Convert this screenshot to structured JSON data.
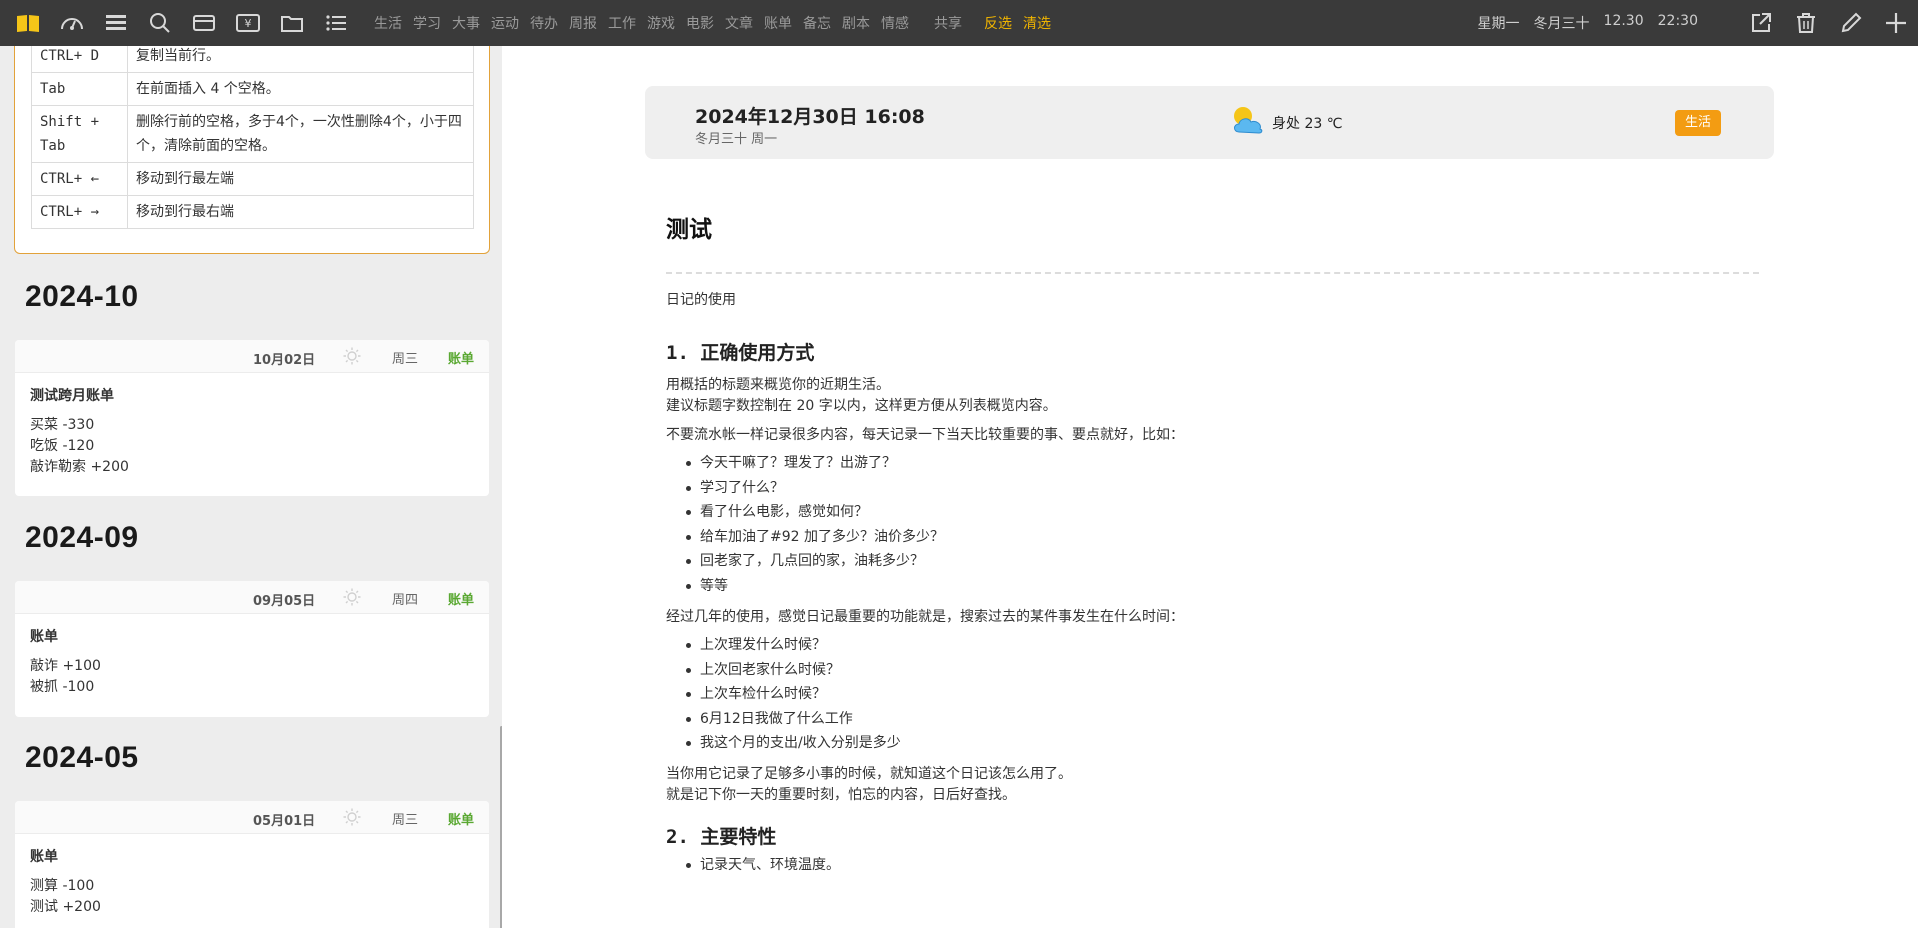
{
  "topbar": {
    "categories": [
      "生活",
      "学习",
      "大事",
      "运动",
      "待办",
      "周报",
      "工作",
      "游戏",
      "电影",
      "文章",
      "账单",
      "备忘",
      "剧本",
      "情感"
    ],
    "share": "共享",
    "invert": "反选",
    "clear": "清选",
    "date": {
      "weekday": "星期一",
      "lunar": "冬月三十",
      "md": "12.30",
      "time": "22:30"
    }
  },
  "shortcuts": [
    {
      "key": "CTRL+ D",
      "desc": "复制当前行。"
    },
    {
      "key": "Tab",
      "desc": "在前面插入 4 个空格。"
    },
    {
      "key": "Shift + Tab",
      "desc": "删除行前的空格，多于4个，一次性删除4个，小于四个，清除前面的空格。"
    },
    {
      "key": "CTRL+ ←",
      "desc": "移动到行最左端"
    },
    {
      "key": "CTRL+ →",
      "desc": "移动到行最右端"
    }
  ],
  "months": [
    {
      "label": "2024-10",
      "entry": {
        "date": "10月02日",
        "weekday": "周三",
        "tag": "账单",
        "title": "测试跨月账单",
        "lines": [
          "买菜 -330",
          "吃饭 -120",
          "敲诈勒索 +200"
        ]
      }
    },
    {
      "label": "2024-09",
      "entry": {
        "date": "09月05日",
        "weekday": "周四",
        "tag": "账单",
        "title": "账单",
        "lines": [
          "敲诈 +100",
          "被抓 -100"
        ]
      }
    },
    {
      "label": "2024-05",
      "entry": {
        "date": "05月01日",
        "weekday": "周三",
        "tag": "账单",
        "title": "账单",
        "lines": [
          "测算 -100",
          "测试 +200"
        ]
      }
    }
  ],
  "meta": {
    "datetime": "2024年12月30日 16:08",
    "lunar": "冬月三十 周一",
    "weather": "身处 23 ℃",
    "tag": "生活"
  },
  "doc": {
    "title": "测试",
    "intro": "日记的使用",
    "h1": "1. 正确使用方式",
    "p1a": "用概括的标题来概览你的近期生活。",
    "p1b": "建议标题字数控制在 20 字以内，这样更方便从列表概览内容。",
    "p2": "不要流水帐一样记录很多内容，每天记录一下当天比较重要的事、要点就好，比如：",
    "list1": [
      "今天干嘛了？理发了？出游了？",
      "学习了什么？",
      "看了什么电影，感觉如何？",
      "给车加油了#92 加了多少？油价多少？",
      "回老家了，几点回的家，油耗多少？",
      "等等"
    ],
    "p3": "经过几年的使用，感觉日记最重要的功能就是，搜索过去的某件事发生在什么时间：",
    "list2": [
      "上次理发什么时候？",
      "上次回老家什么时候？",
      "上次车检什么时候？",
      "6月12日我做了什么工作",
      "我这个月的支出/收入分别是多少"
    ],
    "p4a": "当你用它记录了足够多小事的时候，就知道这个日记该怎么用了。",
    "p4b": "就是记下你一天的重要时刻，怕忘的内容，日后好查找。",
    "h2": "2. 主要特性",
    "list3": [
      "记录天气、环境温度。"
    ]
  }
}
